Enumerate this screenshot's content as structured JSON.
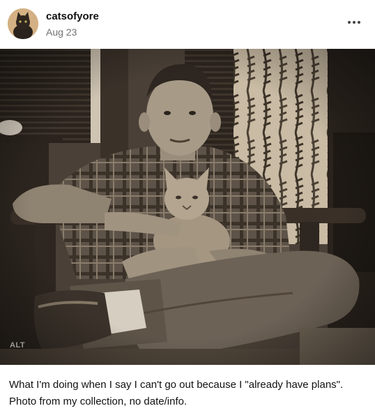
{
  "post": {
    "blog_name": "catsofyore",
    "date": "Aug 23",
    "more_icon": "more-dots-icon",
    "image": {
      "alt_badge": "ALT",
      "description_icon": "photo"
    },
    "caption": "What I'm doing when I say I can't go out because I \"already have plans\". Photo from my collection, no date/info."
  }
}
